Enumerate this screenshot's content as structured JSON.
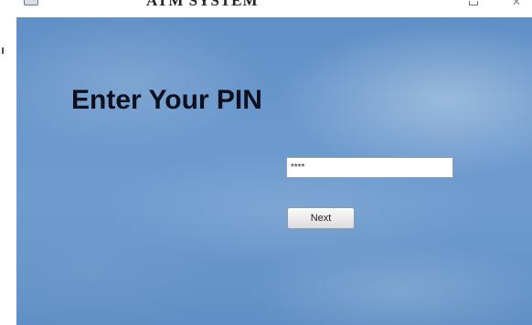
{
  "window": {
    "title": "ATM SYSTEM",
    "app_icon": "window-app-icon",
    "controls": [
      "minimize-icon",
      "close-icon"
    ]
  },
  "main": {
    "heading": "Enter Your PIN",
    "pin_field": {
      "value": "****"
    },
    "next_label": "Next"
  },
  "colors": {
    "sky_top": "#5f8fc6",
    "sky_mid": "#6e9ccf",
    "heading_text": "#0c0f1c",
    "input_bg": "#ffffff"
  }
}
